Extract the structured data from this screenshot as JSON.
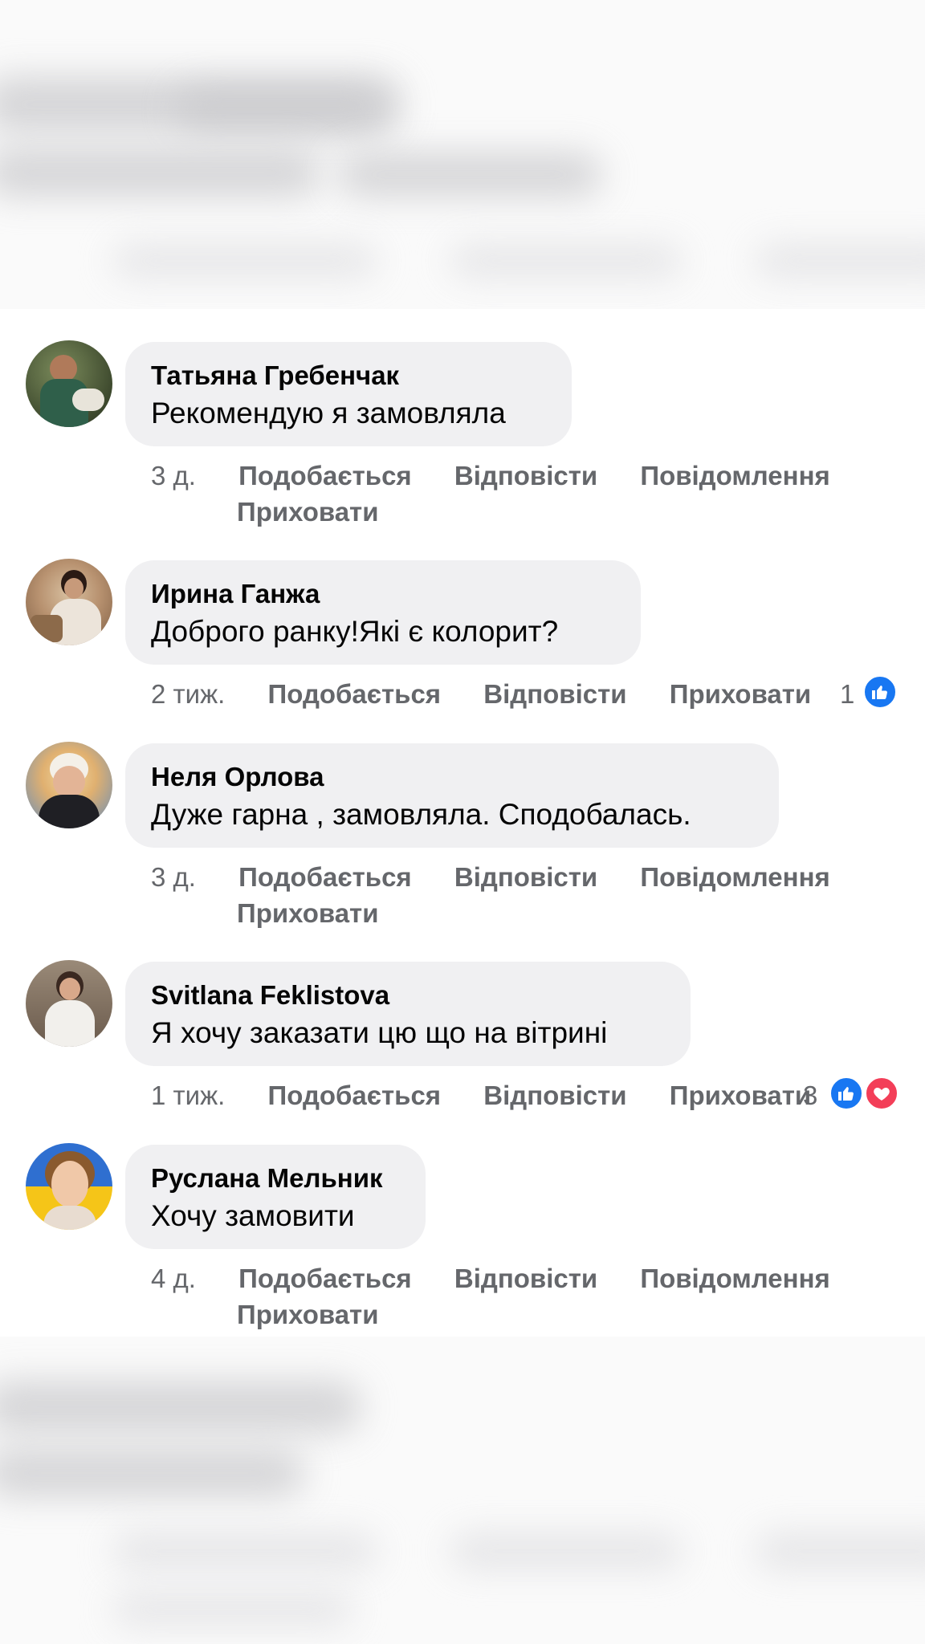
{
  "comments": [
    {
      "author": "Татьяна Гребенчак",
      "text": "Рекомендую я замовляла",
      "time": "3 д.",
      "like": "Подобається",
      "reply": "Відповісти",
      "message": "Повідомлення",
      "hide": "Приховати"
    },
    {
      "author": "Ирина Ганжа",
      "text": "Доброго ранку!Які є колорит?",
      "time": "2 тиж.",
      "like": "Подобається",
      "reply": "Відповісти",
      "hide": "Приховати",
      "reaction_count": "1",
      "reactions": [
        "like-icon"
      ]
    },
    {
      "author": "Неля Орлова",
      "text": "Дуже гарна , замовляла. Сподобалась.",
      "time": "3 д.",
      "like": "Подобається",
      "reply": "Відповісти",
      "message": "Повідомлення",
      "hide": "Приховати"
    },
    {
      "author": "Svitlana Feklistova",
      "text": "Я хочу заказати цю що на вітрині",
      "time": "1 тиж.",
      "like": "Подобається",
      "reply": "Відповісти",
      "hide": "Приховати",
      "reaction_count": "3",
      "reactions": [
        "like-icon",
        "heart-icon"
      ]
    },
    {
      "author": "Руслана Мельник",
      "text": "Хочу замовити",
      "time": "4 д.",
      "like": "Подобається",
      "reply": "Відповісти",
      "message": "Повідомлення",
      "hide": "Приховати"
    }
  ],
  "colors": {
    "bubble": "#f0f0f2",
    "action_text": "#65676b",
    "like_blue": "#1877f2",
    "love_red": "#f33e58"
  }
}
